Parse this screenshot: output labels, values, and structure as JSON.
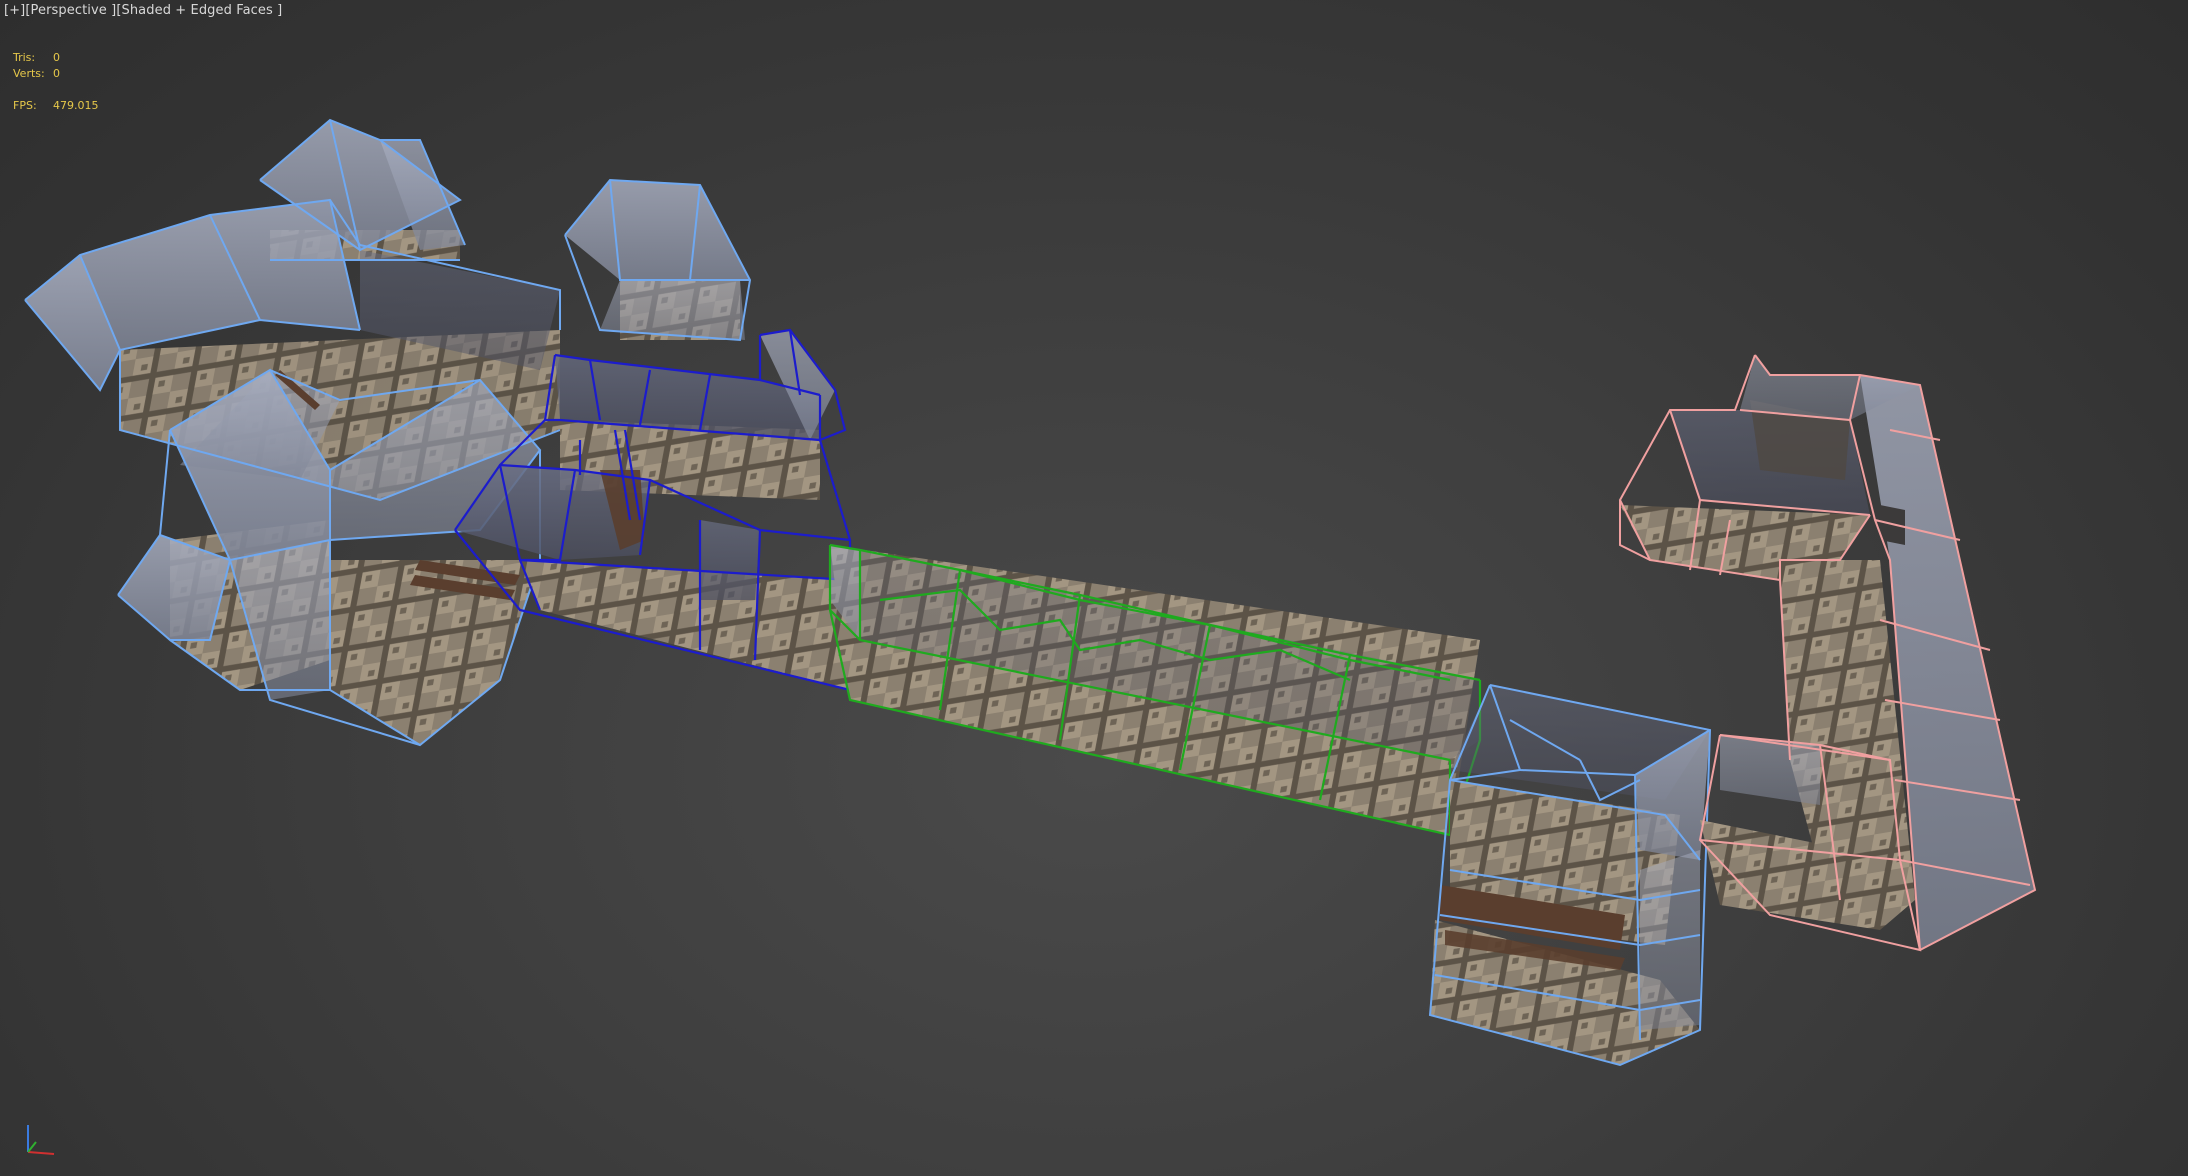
{
  "viewport": {
    "label_plus": "[+]",
    "label_view": "[Perspective ]",
    "label_shading": "[Shaded + Edged Faces ]"
  },
  "stats": {
    "tris_label": "Tris:",
    "tris_value": "0",
    "verts_label": "Verts:",
    "verts_value": "0",
    "fps_label": "FPS:",
    "fps_value": "479.015"
  },
  "colors": {
    "stats_text": "#e6c84a",
    "wire_light_blue": "#6fa8f0",
    "wire_dark_blue": "#1c1ccc",
    "wire_green": "#1faa1f",
    "wire_pink": "#f0a0a0",
    "floor_tile": "#8f8475"
  },
  "icons": {
    "axis_gizmo": "axis-tripod-icon"
  }
}
